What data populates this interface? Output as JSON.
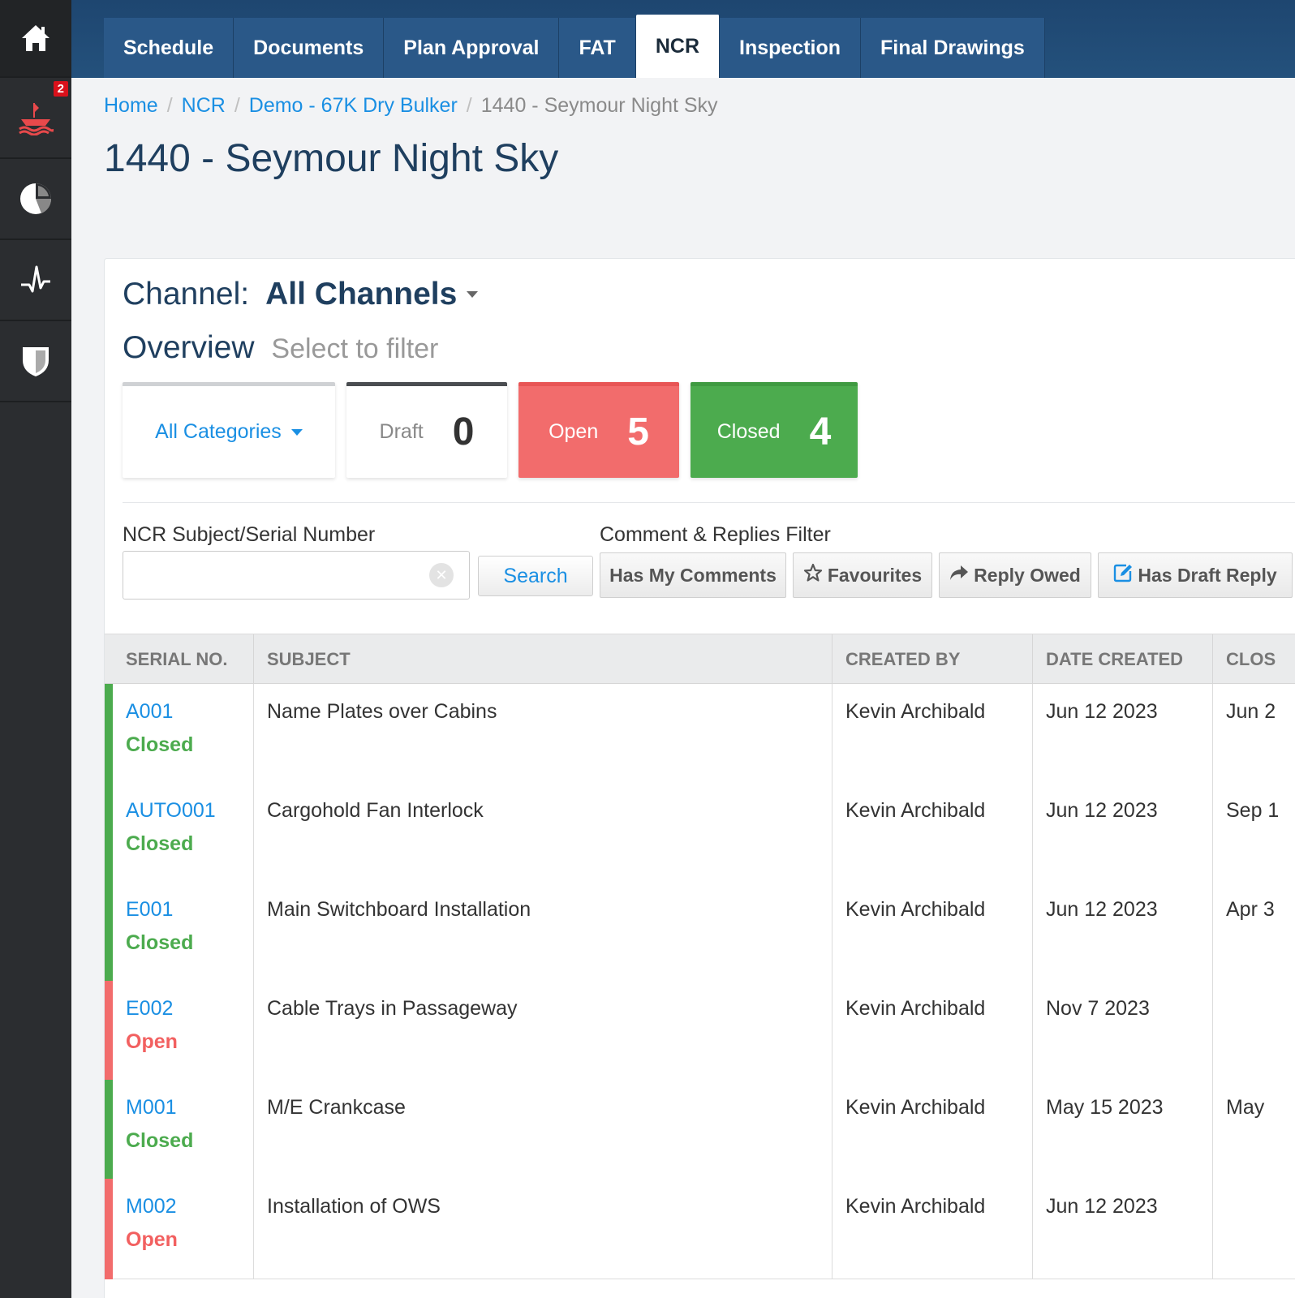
{
  "rail": {
    "badge": "2"
  },
  "tabs": [
    "Schedule",
    "Documents",
    "Plan Approval",
    "FAT",
    "NCR",
    "Inspection",
    "Final Drawings"
  ],
  "active_tab": "NCR",
  "breadcrumb": {
    "home": "Home",
    "ncr": "NCR",
    "project": "Demo - 67K Dry Bulker",
    "current": "1440 - Seymour Night Sky"
  },
  "page_title": "1440 - Seymour Night Sky",
  "channel": {
    "label": "Channel:",
    "value": "All Channels"
  },
  "overview": {
    "title": "Overview",
    "hint": "Select to filter"
  },
  "cards": {
    "categories": "All Categories",
    "draft_label": "Draft",
    "draft_count": "0",
    "open_label": "Open",
    "open_count": "5",
    "closed_label": "Closed",
    "closed_count": "4"
  },
  "search": {
    "label": "NCR Subject/Serial Number",
    "value": "",
    "button": "Search"
  },
  "filters": {
    "label": "Comment & Replies Filter",
    "has_my_comments": "Has My Comments",
    "favourites": "Favourites",
    "reply_owed": "Reply Owed",
    "has_draft_reply": "Has Draft Reply"
  },
  "columns": {
    "serial": "SERIAL NO.",
    "subject": "SUBJECT",
    "created_by": "CREATED BY",
    "date_created": "DATE CREATED",
    "closed": "CLOS"
  },
  "colors": {
    "open": "#f26c6c",
    "closed": "#4cab4e",
    "link": "#1a8fe3"
  },
  "rows": [
    {
      "serial": "A001",
      "status": "Closed",
      "subject": "Name Plates over Cabins",
      "created_by": "Kevin Archibald",
      "date_created": "Jun 12 2023",
      "closed": "Jun 2"
    },
    {
      "serial": "AUTO001",
      "status": "Closed",
      "subject": "Cargohold Fan Interlock",
      "created_by": "Kevin Archibald",
      "date_created": "Jun 12 2023",
      "closed": "Sep 1"
    },
    {
      "serial": "E001",
      "status": "Closed",
      "subject": "Main Switchboard Installation",
      "created_by": "Kevin Archibald",
      "date_created": "Jun 12 2023",
      "closed": "Apr 3"
    },
    {
      "serial": "E002",
      "status": "Open",
      "subject": "Cable Trays in Passageway",
      "created_by": "Kevin Archibald",
      "date_created": "Nov 7 2023",
      "closed": ""
    },
    {
      "serial": "M001",
      "status": "Closed",
      "subject": "M/E Crankcase",
      "created_by": "Kevin Archibald",
      "date_created": "May 15 2023",
      "closed": "May"
    },
    {
      "serial": "M002",
      "status": "Open",
      "subject": "Installation of OWS",
      "created_by": "Kevin Archibald",
      "date_created": "Jun 12 2023",
      "closed": ""
    }
  ]
}
